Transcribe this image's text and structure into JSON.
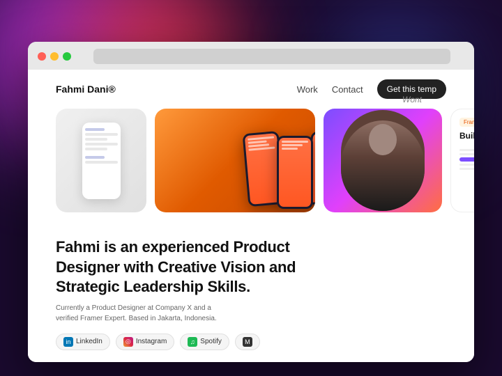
{
  "browser": {
    "traffic_lights": [
      "red",
      "yellow",
      "green"
    ]
  },
  "nav": {
    "logo": "Fahmi Dani®",
    "links": [
      "Work",
      "Contact"
    ],
    "cta": "Get this temp"
  },
  "cards": [
    {
      "id": "card-wireframe",
      "type": "phone-white"
    },
    {
      "id": "card-app",
      "type": "phone-orange"
    },
    {
      "id": "card-portrait",
      "type": "portrait"
    },
    {
      "id": "card-build",
      "type": "build-card",
      "badge": "Framer",
      "title": "Build"
    }
  ],
  "hero": {
    "title": "Fahmi is an experienced Product Designer with Creative Vision and Strategic Leadership Skills.",
    "subtitle": "Currently a Product Designer at Company X and a verified Framer Expert. Based in Jakarta, Indonesia."
  },
  "social": {
    "items": [
      {
        "label": "LinkedIn",
        "icon": "in"
      },
      {
        "label": "Instagram",
        "icon": "◎"
      },
      {
        "label": "Spotify",
        "icon": "♫"
      },
      {
        "label": "M",
        "icon": "M"
      }
    ]
  },
  "wont_text": "Wont"
}
